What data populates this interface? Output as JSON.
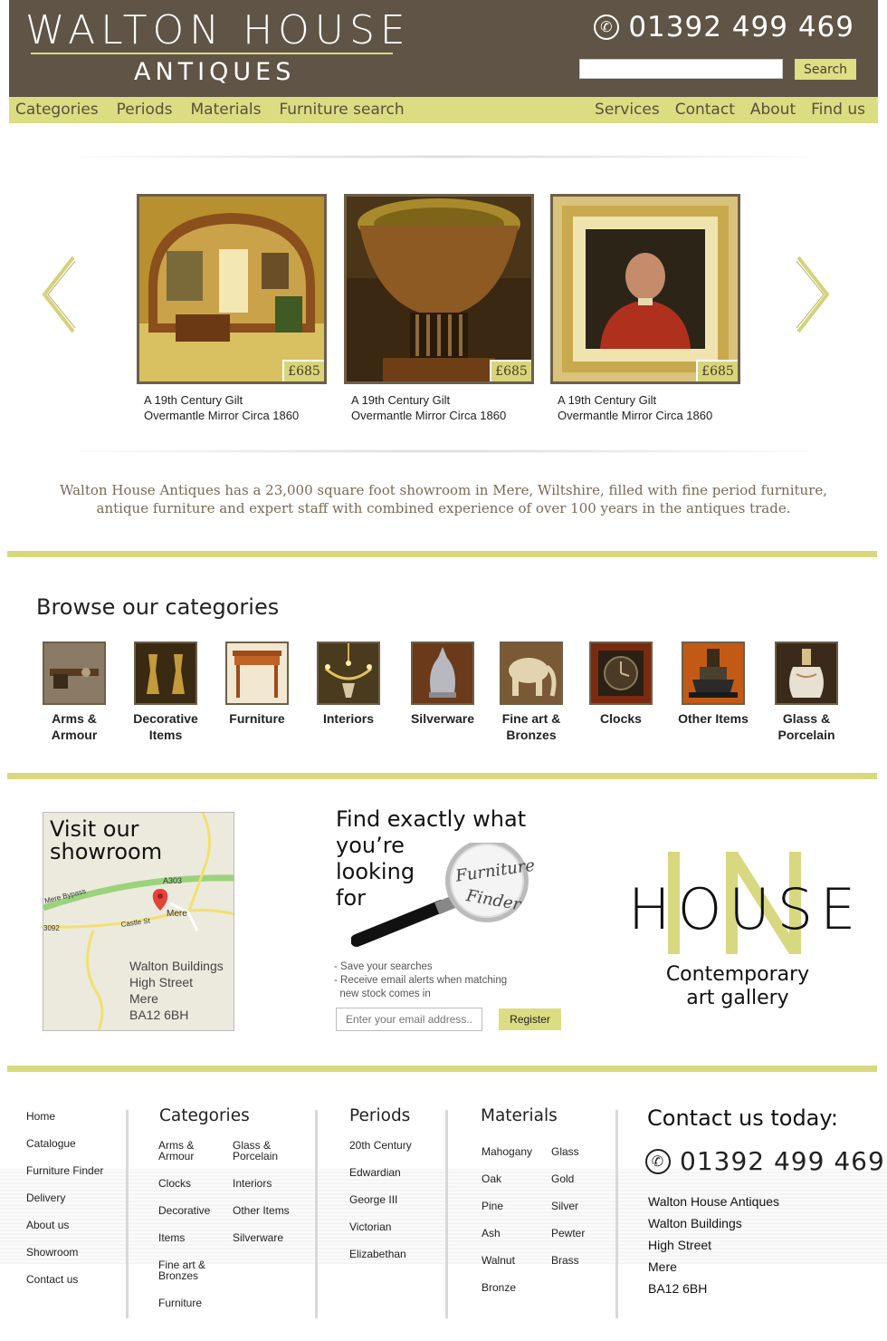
{
  "header": {
    "logo_main": "WALTON HOUSE",
    "logo_sub": "ANTIQUES",
    "phone": "01392 499 469",
    "phone_icon": "phone-icon",
    "search_button": "Search",
    "search_value": ""
  },
  "nav": {
    "left": [
      "Categories",
      "Periods",
      "Materials",
      "Furniture search"
    ],
    "right": [
      "Services",
      "Contact",
      "About",
      "Find us"
    ]
  },
  "carousel": {
    "prev_icon": "chevron-left-icon",
    "next_icon": "chevron-right-icon",
    "products": [
      {
        "price": "£685",
        "title_line1": "A 19th Century Gilt",
        "title_line2": "Overmantle Mirror Circa 1860"
      },
      {
        "price": "£685",
        "title_line1": "A 19th Century Gilt",
        "title_line2": "Overmantle Mirror Circa 1860"
      },
      {
        "price": "£685",
        "title_line1": "A 19th Century Gilt",
        "title_line2": "Overmantle Mirror Circa 1860"
      }
    ]
  },
  "intro": "Walton House Antiques has a 23,000 square foot showroom in Mere, Wiltshire, filled with fine period furniture, antique furniture and expert staff with combined experience of over 100 years in the antiques trade.",
  "browse": {
    "title": "Browse our categories",
    "categories": [
      {
        "line1": "Arms &",
        "line2": "Armour"
      },
      {
        "line1": "Decorative",
        "line2": "Items"
      },
      {
        "line1": "Furniture",
        "line2": ""
      },
      {
        "line1": "Interiors",
        "line2": ""
      },
      {
        "line1": "Silverware",
        "line2": ""
      },
      {
        "line1": "Fine art &",
        "line2": "Bronzes"
      },
      {
        "line1": "Clocks",
        "line2": ""
      },
      {
        "line1": "Other Items",
        "line2": ""
      },
      {
        "line1": "Glass &",
        "line2": "Porcelain"
      }
    ]
  },
  "showroom": {
    "title_line1": "Visit our",
    "title_line2": "showroom",
    "map_labels": {
      "road": "A303",
      "bypass": "Mere Bypass",
      "town": "Mere",
      "street": "Castle St",
      "b_road": "3092"
    },
    "address": [
      "Walton Buildings",
      "High Street",
      "Mere",
      "BA12 6BH"
    ]
  },
  "finder": {
    "title": [
      "Find exactly what",
      "you’re",
      "looking",
      "for"
    ],
    "lens_line1": "Furniture",
    "lens_line2": "Finder",
    "bullets": [
      "- Save your searches",
      "- Receive email alerts when matching",
      "  new stock comes in"
    ],
    "email_placeholder": "Enter your email address...",
    "register": "Register"
  },
  "inhouse": {
    "word": "HOUSE",
    "overlay": "IN",
    "sub_line1": "Contemporary",
    "sub_line2": "art gallery"
  },
  "footer": {
    "links": [
      "Home",
      "Catalogue",
      "Furniture Finder",
      "Delivery",
      "About us",
      "Showroom",
      "Contact us"
    ],
    "categories_title": "Categories",
    "categories": [
      {
        "text": "Arms &\nArmour"
      },
      {
        "text": "Glass &\nPorcelain"
      },
      {
        "text": "Clocks"
      },
      {
        "text": "Interiors"
      },
      {
        "text": "Decorative"
      },
      {
        "text": "Other Items"
      },
      {
        "text": "Items"
      },
      {
        "text": "Silverware"
      },
      {
        "text": "Fine art &\nBronzes"
      },
      {
        "text": "Furniture"
      }
    ],
    "periods_title": "Periods",
    "periods": [
      "20th Century",
      "Edwardian",
      "George III",
      "Victorian",
      "Elizabethan"
    ],
    "materials_title": "Materials",
    "materials_left": [
      "Mahogany",
      "Oak",
      "Pine",
      "Ash",
      "Walnut",
      "Bronze"
    ],
    "materials_right": [
      "Glass",
      "Gold",
      "Silver",
      "Pewter",
      "Brass"
    ],
    "contact_title": "Contact us today:",
    "phone": "01392 499 469",
    "address": [
      "Walton House Antiques",
      "Walton Buildings",
      "High Street",
      "Mere",
      "BA12 6BH"
    ]
  },
  "colors": {
    "header_bg": "#5f5445",
    "accent": "#dcdc82",
    "frame": "#6d5f49"
  }
}
